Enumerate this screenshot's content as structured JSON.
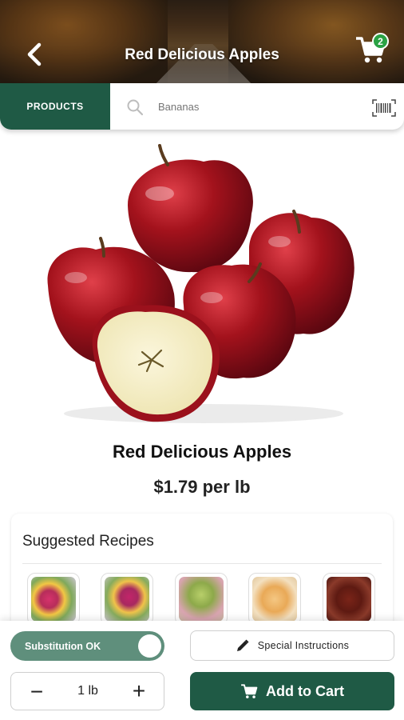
{
  "header": {
    "title": "Red Delicious Apples",
    "back_icon": "chevron-left-icon",
    "cart_icon": "cart-icon",
    "cart_count": "2"
  },
  "search": {
    "tab_label": "PRODUCTS",
    "placeholder": "Bananas",
    "search_icon": "search-icon",
    "barcode_icon": "barcode-icon"
  },
  "product": {
    "name": "Red Delicious Apples",
    "price": "$1.79 per lb"
  },
  "recipes": {
    "title": "Suggested Recipes",
    "items": [
      "recipe-1",
      "recipe-2",
      "recipe-3",
      "recipe-4",
      "recipe-5"
    ]
  },
  "actions": {
    "substitution_label": "Substitution OK",
    "substitution_on": true,
    "special_instructions_label": "Special Instructions",
    "quantity_value": "1 lb",
    "minus_label": "−",
    "plus_label": "+",
    "add_to_cart_label": "Add to Cart"
  },
  "colors": {
    "brand_green": "#1f5a45",
    "badge_green": "#2aa244",
    "toggle_green": "#5f8f7c",
    "apple_red": "#a3121c"
  }
}
